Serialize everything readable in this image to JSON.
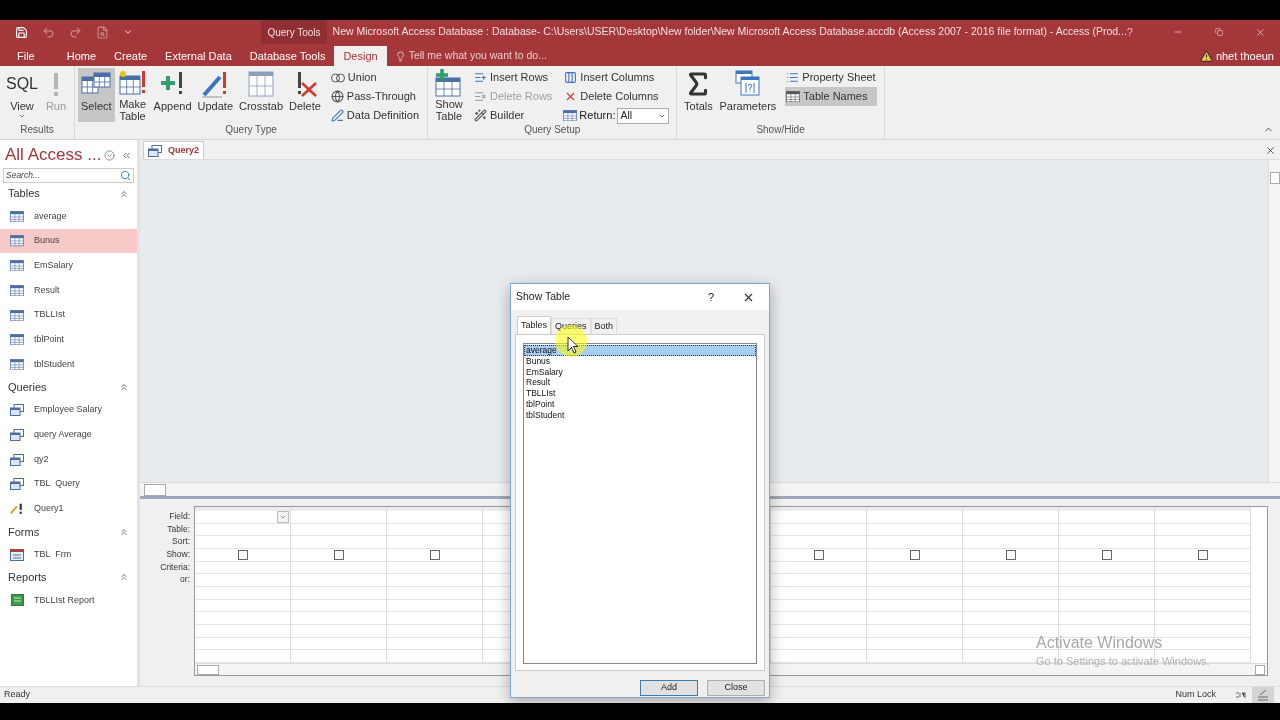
{
  "title_bar": {
    "context": "Query Tools",
    "title": "New Microsoft Access Database : Database- C:\\Users\\USER\\Desktop\\New folder\\New Microsoft Access Database.accdb (Access 2007 - 2016 file format) - Access (Prod...",
    "help": "?"
  },
  "ribbon_tabs": [
    {
      "label": "File",
      "selected": false
    },
    {
      "label": "Home",
      "selected": false
    },
    {
      "label": "Create",
      "selected": false
    },
    {
      "label": "External Data",
      "selected": false
    },
    {
      "label": "Database Tools",
      "selected": false
    },
    {
      "label": "Design",
      "selected": true
    }
  ],
  "tell_me": {
    "placeholder": "Tell me what you want to do..."
  },
  "user": {
    "name": "nhet thoeun"
  },
  "ribbon_groups": [
    {
      "label": "Results",
      "large": [
        {
          "label": "View",
          "glyph": "SQL",
          "disabled": false,
          "selected": false,
          "menu": true
        },
        {
          "label": "Run",
          "disabled": true,
          "selected": false
        }
      ]
    },
    {
      "label": "Query Type",
      "large": [
        {
          "label": "Select",
          "disabled": false,
          "selected": true
        },
        {
          "label": "Make Table",
          "disabled": false,
          "selected": false
        },
        {
          "label": "Append",
          "disabled": false,
          "selected": false
        },
        {
          "label": "Update",
          "disabled": false,
          "selected": false
        },
        {
          "label": "Crosstab",
          "disabled": false,
          "selected": false
        },
        {
          "label": "Delete",
          "disabled": false,
          "selected": false
        }
      ],
      "small_columns": [
        [
          {
            "kind": "button",
            "label": "Union",
            "disabled": false,
            "selected": false
          },
          {
            "kind": "button",
            "label": "Pass-Through",
            "disabled": false,
            "selected": false
          },
          {
            "kind": "button",
            "label": "Data Definition",
            "disabled": false,
            "selected": false
          }
        ]
      ]
    },
    {
      "label": "Query Setup",
      "large": [
        {
          "label": "Show Table",
          "disabled": false,
          "selected": false
        }
      ],
      "small_columns": [
        [
          {
            "kind": "button",
            "label": "Insert Rows",
            "disabled": false,
            "selected": false
          },
          {
            "kind": "button",
            "label": "Delete Rows",
            "disabled": true,
            "selected": false
          },
          {
            "kind": "button",
            "label": "Builder",
            "disabled": false,
            "selected": false
          }
        ],
        [
          {
            "kind": "button",
            "label": "Insert Columns",
            "disabled": false,
            "selected": false
          },
          {
            "kind": "button",
            "label": "Delete Columns",
            "disabled": false,
            "selected": false
          },
          {
            "kind": "combo",
            "label": "Return:",
            "value": "All",
            "disabled": false,
            "selected": false
          }
        ]
      ]
    },
    {
      "label": "Show/Hide",
      "large": [
        {
          "label": "Totals",
          "disabled": false,
          "selected": false
        },
        {
          "label": "Parameters",
          "disabled": false,
          "selected": false
        }
      ],
      "small_columns": [
        [
          {
            "kind": "button",
            "label": "Property Sheet",
            "disabled": false,
            "selected": false
          },
          {
            "kind": "button",
            "label": "Table Names",
            "disabled": false,
            "selected": true
          }
        ]
      ]
    }
  ],
  "nav_pane": {
    "title": "All Access ...",
    "search": {
      "placeholder": "Search..."
    },
    "sections": [
      {
        "title": "Tables",
        "expanded": true,
        "items": [
          {
            "label": "average",
            "kind": "table",
            "selected": false
          },
          {
            "label": "Bunus",
            "kind": "table",
            "selected": true
          },
          {
            "label": "EmSalary",
            "kind": "table",
            "selected": false
          },
          {
            "label": "Result",
            "kind": "table",
            "selected": false
          },
          {
            "label": "TBLLIst",
            "kind": "table",
            "selected": false
          },
          {
            "label": "tblPoint",
            "kind": "table",
            "selected": false
          },
          {
            "label": "tblStudent",
            "kind": "table",
            "selected": false
          }
        ]
      },
      {
        "title": "Queries",
        "expanded": true,
        "items": [
          {
            "label": "Employee Salary",
            "kind": "query",
            "selected": false
          },
          {
            "label": "query Average",
            "kind": "query",
            "selected": false
          },
          {
            "label": "qy2",
            "kind": "query",
            "selected": false
          },
          {
            "label": "TBL  Query",
            "kind": "query",
            "selected": false
          },
          {
            "label": "Query1",
            "kind": "action_query",
            "selected": false
          }
        ]
      },
      {
        "title": "Forms",
        "expanded": true,
        "items": [
          {
            "label": "TBL  Frm",
            "kind": "form",
            "selected": false
          }
        ]
      },
      {
        "title": "Reports",
        "expanded": true,
        "items": [
          {
            "label": "TBLLIst Report",
            "kind": "report",
            "selected": false
          }
        ]
      }
    ]
  },
  "document": {
    "tabs": [
      {
        "label": "Query2",
        "selected": true
      }
    ],
    "grid": {
      "row_labels": [
        "Field:",
        "Table:",
        "Sort:",
        "Show:",
        "Criteria:",
        "or:"
      ],
      "columns": [
        {
          "active": true,
          "show": false
        },
        {
          "active": false,
          "show": false
        },
        {
          "active": false,
          "show": false
        },
        {},
        {},
        {},
        {
          "active": false,
          "show": false
        },
        {
          "active": false,
          "show": false
        },
        {
          "active": false,
          "show": false
        },
        {
          "active": false,
          "show": false
        },
        {
          "active": false,
          "show": false
        }
      ]
    }
  },
  "dialog": {
    "title": "Show Table",
    "help": "?",
    "tabs": [
      {
        "label": "Tables",
        "selected": true
      },
      {
        "label": "Queries",
        "selected": false
      },
      {
        "label": "Both",
        "selected": false
      }
    ],
    "items": [
      {
        "label": "average",
        "selected": true
      },
      {
        "label": "Bunus",
        "selected": false
      },
      {
        "label": "EmSalary",
        "selected": false
      },
      {
        "label": "Result",
        "selected": false
      },
      {
        "label": "TBLLIst",
        "selected": false
      },
      {
        "label": "tblPoint",
        "selected": false
      },
      {
        "label": "tblStudent",
        "selected": false
      }
    ],
    "buttons": [
      {
        "label": "Add",
        "default": true
      },
      {
        "label": "Close",
        "default": false
      }
    ]
  },
  "activation_notice": {
    "title": "Activate Windows",
    "text": "Go to Settings to activate Windows."
  },
  "status_bar": {
    "text": "Ready",
    "indicators": [
      "Num Lock"
    ],
    "views": [
      {
        "kind": "sql",
        "selected": false
      },
      {
        "kind": "design",
        "selected": true
      }
    ]
  }
}
